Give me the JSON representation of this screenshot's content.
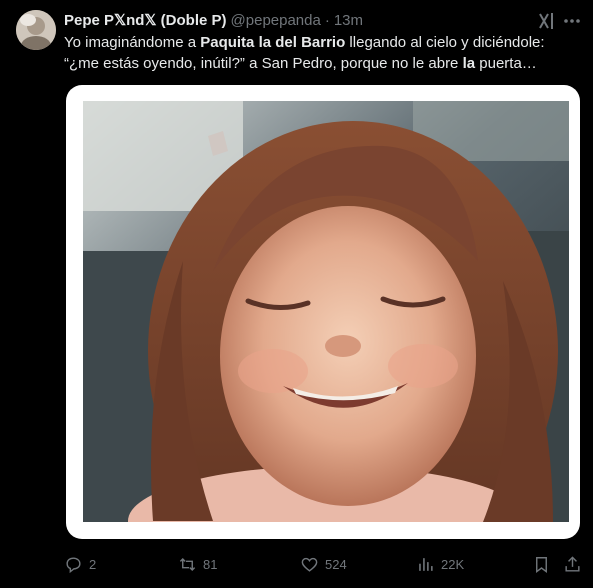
{
  "tweet": {
    "author_name": "Pepe P𝕏nd𝕏 (Doble P)",
    "handle": "@pepepanda",
    "separator": "·",
    "time": "13m",
    "text_parts": {
      "p1": "Yo imaginándome a ",
      "b1": "Paquita la del Barrio",
      "p2": " llegando al cielo y diciéndole: “¿me estás oyendo, inútil?” a San Pedro, porque no le abre ",
      "b2": "la",
      "p3": " puerta…"
    }
  },
  "actions": {
    "replies": "2",
    "reposts": "81",
    "likes": "524",
    "views": "22K"
  },
  "icons": {
    "grok": "grok-icon",
    "more": "more-icon",
    "reply": "reply-icon",
    "repost": "repost-icon",
    "like": "heart-icon",
    "views": "views-icon",
    "bookmark": "bookmark-icon",
    "share": "share-icon"
  },
  "colors": {
    "background": "#000000",
    "text": "#e7e9ea",
    "secondary": "#71767b",
    "media_border": "#ffffff"
  }
}
